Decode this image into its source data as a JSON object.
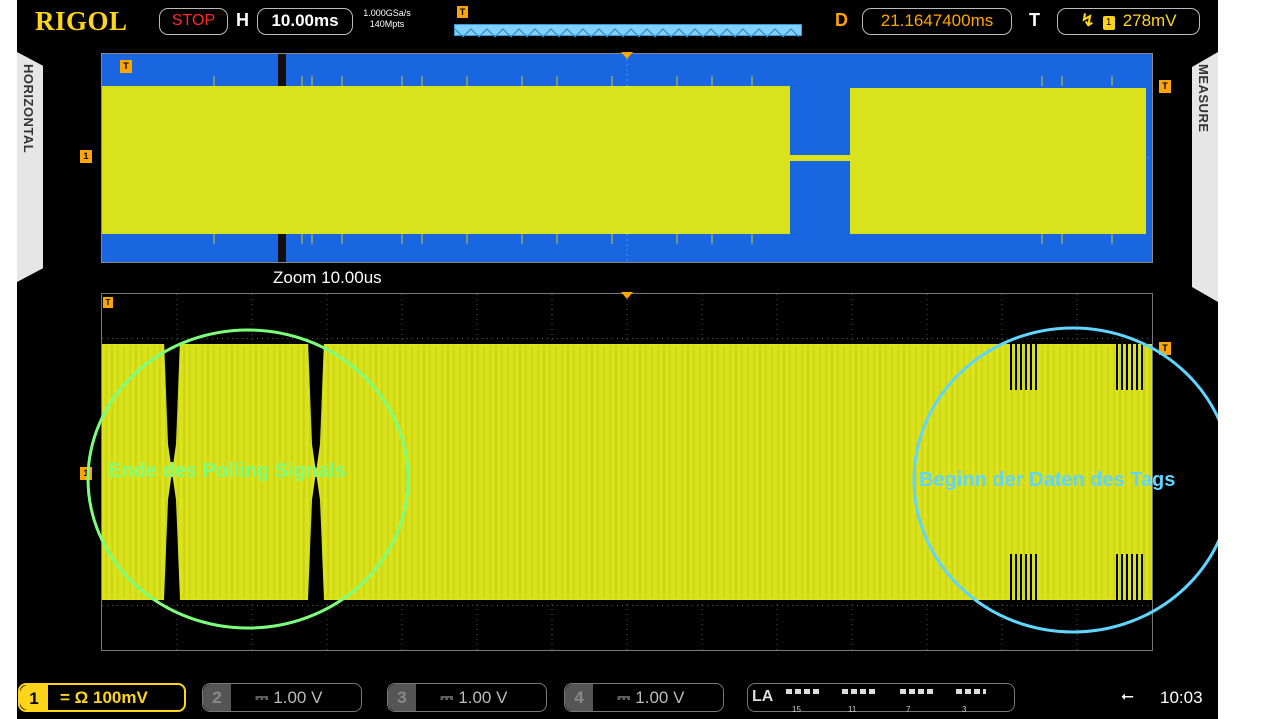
{
  "topbar": {
    "brand": "RIGOL",
    "run_status": "STOP",
    "horizontal_label": "H",
    "timebase": "10.00ms",
    "sample_rate": "1.000GSa/s",
    "memory_depth": "140Mpts",
    "delay_label": "D",
    "delay_value": "21.1647400ms",
    "trigger_label": "T",
    "trigger_source": "1",
    "trigger_level": "278mV"
  },
  "side_tabs": {
    "left": "HORIZONTAL",
    "right": "MEASURE"
  },
  "zoom_label": "Zoom  10.00us",
  "annotations": {
    "left": "Ende des Polling Signals",
    "right": "Beginn der Daten des Tags"
  },
  "channels": [
    {
      "num": "1",
      "value": "= Ω 100mV"
    },
    {
      "num": "2",
      "value": "⎓   1.00 V"
    },
    {
      "num": "3",
      "value": "⎓   1.00 V"
    },
    {
      "num": "4",
      "value": "⎓   1.00 V"
    }
  ],
  "logic_analyzer": {
    "label": "LA",
    "indices": [
      "15",
      "11",
      "7",
      "3"
    ]
  },
  "clock": "10:03",
  "colors": {
    "waveform": "#d9e21a",
    "main_window_bg": "#1a66e0",
    "trigger_marker": "#ffa500",
    "ellipse_left": "#7dff7d",
    "ellipse_right": "#5fd6ff"
  }
}
